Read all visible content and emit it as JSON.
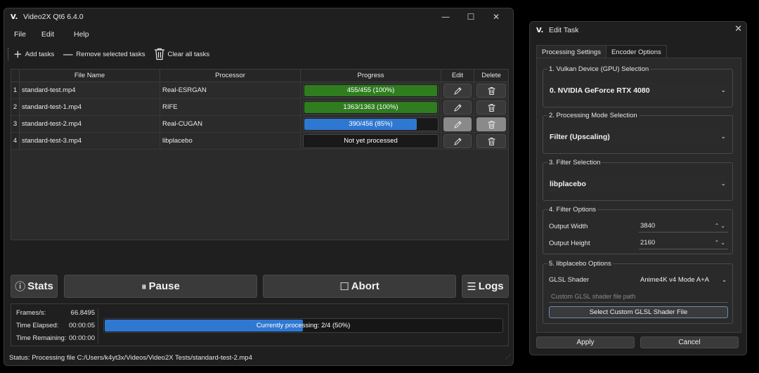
{
  "main_window": {
    "logo": "V.",
    "title": "Video2X Qt6 6.4.0",
    "controls": {
      "minimize": "—",
      "maximize": "☐",
      "close": "✕"
    },
    "menu": [
      "File",
      "Edit",
      "Help"
    ],
    "toolbar": {
      "add_tasks": "Add tasks",
      "remove_selected": "Remove selected tasks",
      "clear_all": "Clear all tasks"
    },
    "table": {
      "headers": [
        "File Name",
        "Processor",
        "Progress",
        "Edit",
        "Delete"
      ],
      "rows": [
        {
          "num": "1",
          "file": "standard-test.mp4",
          "processor": "Real-ESRGAN",
          "progress_text": "455/455 (100%)",
          "progress": 1.0,
          "color": "#2f7d1f",
          "enabled": true
        },
        {
          "num": "2",
          "file": "standard-test-1.mp4",
          "processor": "RIFE",
          "progress_text": "1363/1363 (100%)",
          "progress": 1.0,
          "color": "#2f7d1f",
          "enabled": true
        },
        {
          "num": "3",
          "file": "standard-test-2.mp4",
          "processor": "Real-CUGAN",
          "progress_text": "390/456 (85%)",
          "progress": 0.85,
          "color": "#2f78d2",
          "enabled": false
        },
        {
          "num": "4",
          "file": "standard-test-3.mp4",
          "processor": "libplacebo",
          "progress_text": "Not yet processed",
          "progress": 0,
          "color": "#2f78d2",
          "enabled": true
        }
      ]
    },
    "actions": {
      "stats": "Stats",
      "pause": "Pause",
      "abort": "Abort",
      "logs": "Logs"
    },
    "stats": {
      "frames_label": "Frames/s:",
      "frames_value": "66.8495",
      "elapsed_label": "Time Elapsed:",
      "elapsed_value": "00:00:05",
      "remaining_label": "Time Remaining:",
      "remaining_value": "00:00:00",
      "overall_text": "Currently processing: 2/4 (50%)",
      "overall_progress": 0.5
    },
    "status": "Status: Processing file C:/Users/k4yt3x/Videos/Video2X Tests/standard-test-2.mp4"
  },
  "edit_dialog": {
    "logo": "V.",
    "title": "Edit Task",
    "close": "✕",
    "tabs": [
      "Processing Settings",
      "Encoder Options"
    ],
    "group1": {
      "legend": "1. Vulkan Device (GPU) Selection",
      "value": "0. NVIDIA GeForce RTX 4080"
    },
    "group2": {
      "legend": "2. Processing Mode Selection",
      "value": "Filter (Upscaling)"
    },
    "group3": {
      "legend": "3. Filter Selection",
      "value": "libplacebo"
    },
    "group4": {
      "legend": "4. Filter Options",
      "width_label": "Output Width",
      "width_value": "3840",
      "height_label": "Output Height",
      "height_value": "2160"
    },
    "group5": {
      "legend": "5. libplacebo Options",
      "shader_label": "GLSL Shader",
      "shader_value": "Anime4K v4 Mode A+A",
      "path_placeholder": "Custom GLSL shader file path",
      "select_button": "Select Custom GLSL Shader File"
    },
    "apply": "Apply",
    "cancel": "Cancel"
  }
}
